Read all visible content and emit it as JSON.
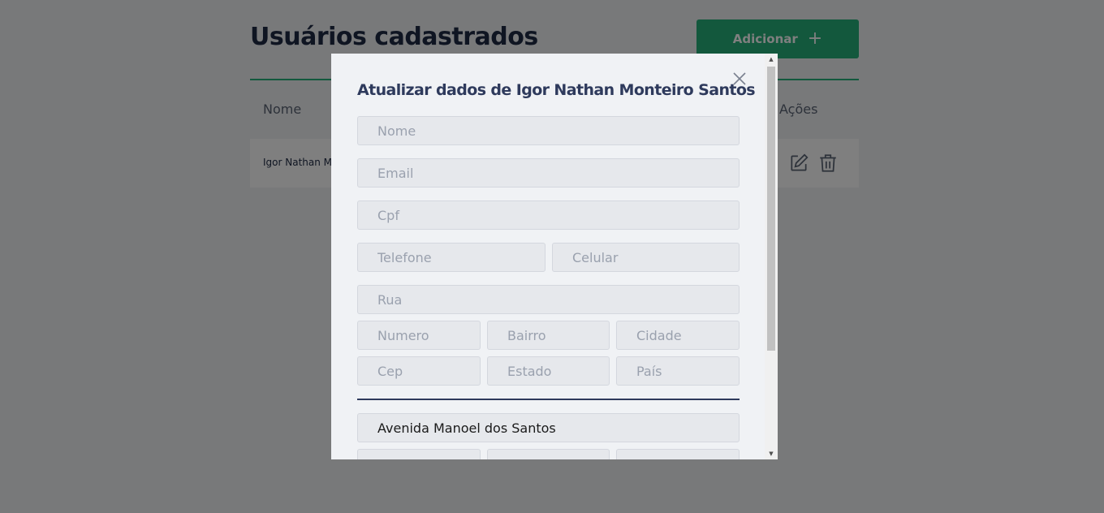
{
  "page": {
    "title": "Usuários cadastrados",
    "add_button_label": "Adicionar",
    "add_button_icon": "plus-icon",
    "table": {
      "columns": [
        "Nome",
        "Ações"
      ],
      "rows": [
        {
          "name": "Igor Nathan M"
        }
      ]
    }
  },
  "modal": {
    "title": "Atualizar dados de Igor Nathan Monteiro Santos",
    "fields": {
      "nome": "Nome",
      "email": "Email",
      "cpf": "Cpf",
      "telefone": "Telefone",
      "celular": "Celular",
      "rua": "Rua",
      "numero": "Numero",
      "bairro": "Bairro",
      "cidade": "Cidade",
      "cep": "Cep",
      "estado": "Estado",
      "pais": "País"
    },
    "address": {
      "street_value": "Avenida Manoel dos Santos"
    }
  },
  "colors": {
    "accent": "#27b07a",
    "title": "#1e2a44",
    "modal_title": "#2e3a5c"
  }
}
